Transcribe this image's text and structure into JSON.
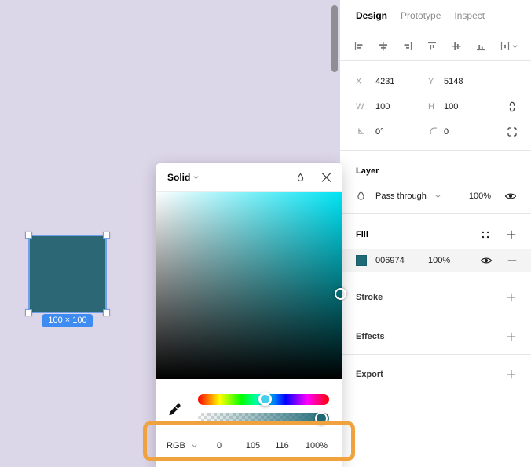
{
  "canvas": {
    "size_badge": "100 × 100"
  },
  "color_picker": {
    "title": "Solid",
    "rgb_mode": "RGB",
    "values": {
      "r": "0",
      "g": "105",
      "b": "116",
      "alpha": "100%"
    }
  },
  "inspector": {
    "tabs": [
      {
        "label": "Design"
      },
      {
        "label": "Prototype"
      },
      {
        "label": "Inspect"
      }
    ],
    "properties": {
      "x_label": "X",
      "x_value": "4231",
      "y_label": "Y",
      "y_value": "5148",
      "w_label": "W",
      "w_value": "100",
      "h_label": "H",
      "h_value": "100",
      "rotation_value": "0°",
      "corner_radius_value": "0"
    },
    "layer": {
      "title": "Layer",
      "blend_mode": "Pass through",
      "opacity": "100%"
    },
    "fill": {
      "title": "Fill",
      "hex": "006974",
      "opacity": "100%"
    },
    "stroke": {
      "title": "Stroke"
    },
    "effects": {
      "title": "Effects"
    },
    "export": {
      "title": "Export"
    }
  },
  "colors": {
    "canvas_background": "#DCD6E9",
    "shape_fill": "#2C6776",
    "selection_blue": "#6FA0E8",
    "size_badge_blue": "#3E8BF1",
    "fill_swatch": "#1F6A77",
    "picker_hue_top_right": "#00E4F5",
    "highlight_orange": "#F0A23E"
  },
  "icons": [
    "chevron-down-icon",
    "droplet-icon",
    "close-icon",
    "eyedropper-icon",
    "eye-icon",
    "plus-icon",
    "minus-icon",
    "fill-styles-icon",
    "constrain-proportions-icon",
    "rotation-icon",
    "corner-radius-icon",
    "independent-corners-icon",
    "align-left-icon",
    "align-horizontal-centers-icon",
    "align-right-icon",
    "align-top-icon",
    "align-vertical-centers-icon",
    "align-bottom-icon",
    "distribute-icon"
  ]
}
